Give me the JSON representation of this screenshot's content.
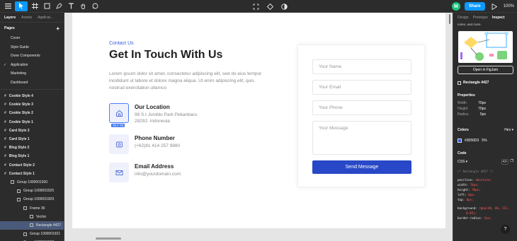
{
  "toolbar": {
    "avatar_initial": "M",
    "share_label": "Share",
    "zoom_label": "100%"
  },
  "left_panel": {
    "tabs": [
      "Layers",
      "Assets",
      "Applicat..."
    ],
    "pages_label": "Pages",
    "pages": [
      "Cover",
      "Style Guide",
      "Done Components",
      "Application",
      "Marketing",
      "Dashboard"
    ],
    "layers": [
      {
        "label": "Cookie Style 4",
        "indent": 0,
        "bold": true
      },
      {
        "label": "Cookie Style 3",
        "indent": 0,
        "bold": true
      },
      {
        "label": "Cookie Style 2",
        "indent": 0,
        "bold": true
      },
      {
        "label": "Cookie Style 1",
        "indent": 0,
        "bold": true
      },
      {
        "label": "Card Style 2",
        "indent": 0,
        "bold": true
      },
      {
        "label": "Card Style 1",
        "indent": 0,
        "bold": true
      },
      {
        "label": "Blog Style 2",
        "indent": 0,
        "bold": true
      },
      {
        "label": "Blog Style 1",
        "indent": 0,
        "bold": true
      },
      {
        "label": "Contact Style 2",
        "indent": 0,
        "bold": true
      },
      {
        "label": "Contact Style 1",
        "indent": 0,
        "bold": true
      },
      {
        "label": "Group 1000001930",
        "indent": 1,
        "bold": false
      },
      {
        "label": "Group 1000001925",
        "indent": 2,
        "bold": false
      },
      {
        "label": "Group 1000001929",
        "indent": 2,
        "bold": false
      },
      {
        "label": "Frame 36",
        "indent": 3,
        "bold": false
      },
      {
        "label": "Vector",
        "indent": 4,
        "bold": false
      },
      {
        "label": "Rectangle 4427",
        "indent": 4,
        "bold": false,
        "selected": true
      },
      {
        "label": "Group 1000001921",
        "indent": 3,
        "bold": false
      },
      {
        "label": "Group 1000001927",
        "indent": 2,
        "bold": false
      }
    ]
  },
  "canvas": {
    "eyebrow": "Contact Us",
    "heading": "Get In Touch With Us",
    "paragraph": "Lorem ipsum dolor sit amet, consectetur adipiscing elit, sed do eius tempor incididunt ut labore et dolore magna aliqua. Ut enim adipiscing elit, quis nostrud exercitation ullamco",
    "size_badge": "70 × 70",
    "location": {
      "title": "Our Location",
      "line1": "99 S.t Jomblo Park Pekanbaru",
      "line2": "28292. Indonesia"
    },
    "phone": {
      "title": "Phone Number",
      "line1": "(+62)81 414 257 9980"
    },
    "email": {
      "title": "Email Address",
      "line1": "info@yourdomain.com"
    },
    "form": {
      "name_placeholder": "Your Name",
      "email_placeholder": "Your Email",
      "phone_placeholder": "Your Phone",
      "message_placeholder": "Your Message",
      "send_label": "Send Message"
    }
  },
  "right_panel": {
    "tabs": [
      "Design",
      "Prototype",
      "Inspect"
    ],
    "note": "notes, and more.",
    "open_button": "Open in FigJam",
    "selection_name": "Rectangle 4427",
    "properties_title": "Properties",
    "props": [
      {
        "key": "Width",
        "val": "70px"
      },
      {
        "key": "Height",
        "val": "70px"
      },
      {
        "key": "Radius",
        "val": "5px"
      }
    ],
    "colors_title": "Colors",
    "colors_format": "Hex",
    "color_hex": "#3056D3",
    "color_opacity": "5%",
    "swatch_color": "#3056d3",
    "code_title": "Code",
    "code_lang": "CSS",
    "code_comment": "/* Rectangle 4427 */",
    "code_lines": [
      {
        "k": "position",
        "v": "absolute;"
      },
      {
        "k": "width",
        "v": "70px;"
      },
      {
        "k": "height",
        "v": "70px;"
      },
      {
        "k": "left",
        "v": "0px;"
      },
      {
        "k": "top",
        "v": "0px;"
      }
    ],
    "code_bg_key": "background",
    "code_bg_val": "rgba(48, 86, 211,",
    "code_bg_val2": "0.05);",
    "code_radius_key": "border-radius",
    "code_radius_val": "5px;"
  },
  "help_label": "?"
}
